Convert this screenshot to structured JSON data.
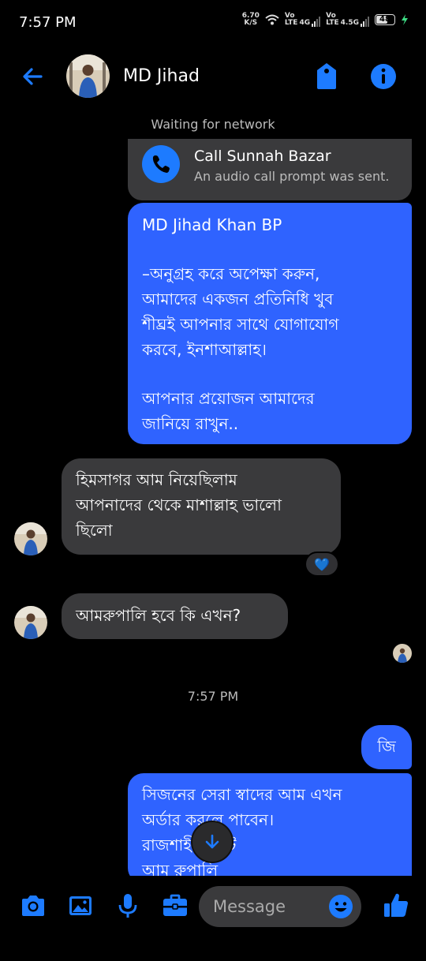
{
  "status_bar": {
    "time": "7:57 PM",
    "net_speed_value": "6.70",
    "net_speed_unit": "K/S",
    "sim1_top": "Vo",
    "sim1_bottom": "LTE",
    "sim1_network": "4G",
    "sim2_top": "Vo",
    "sim2_bottom": "LTE",
    "sim2_network": "4.5G",
    "battery": "48"
  },
  "header": {
    "contact_name": "MD Jihad"
  },
  "network_status": "Waiting for network",
  "call_card": {
    "title": "Call Sunnah Bazar",
    "subtitle": "An audio call prompt was sent."
  },
  "messages": {
    "m1_name": "MD Jihad Khan BP",
    "m1_body": "–অনুগ্রহ করে অপেক্ষা করুন,\nআমাদের একজন প্রতিনিধি খুব\nশীঘ্রই আপনার সাথে যোগাযোগ\nকরবে, ইনশাআল্লাহ।",
    "m1_footer": "আপনার প্রয়োজন আমাদের\nজানিয়ে রাখুন..",
    "m2": "হিমসাগর আম নিয়েছিলাম\nআপনাদের থেকে মাশাল্লাহ ভালো\nছিলো",
    "m2_reaction": "💙",
    "m3": "আমরুপালি হবে কি এখন?",
    "time_separator": "7:57 PM",
    "m4": "জি",
    "m5": "সিজনের সেরা স্বাদের আম এখন\nঅর্ডার করলে পাবেন।\nরাজশাহীর মাটি\nআম রুপালি"
  },
  "composer": {
    "placeholder": "Message"
  },
  "colors": {
    "accent": "#1d7bff",
    "outgoing_bubble": "#2f63ff",
    "incoming_bubble": "#3a3a3c",
    "background": "#000000"
  },
  "icons": [
    "back-arrow-icon",
    "tag-icon",
    "info-icon",
    "phone-icon",
    "arrow-down-icon",
    "camera-icon",
    "image-icon",
    "microphone-icon",
    "briefcase-icon",
    "emoji-icon",
    "thumbs-up-icon"
  ]
}
